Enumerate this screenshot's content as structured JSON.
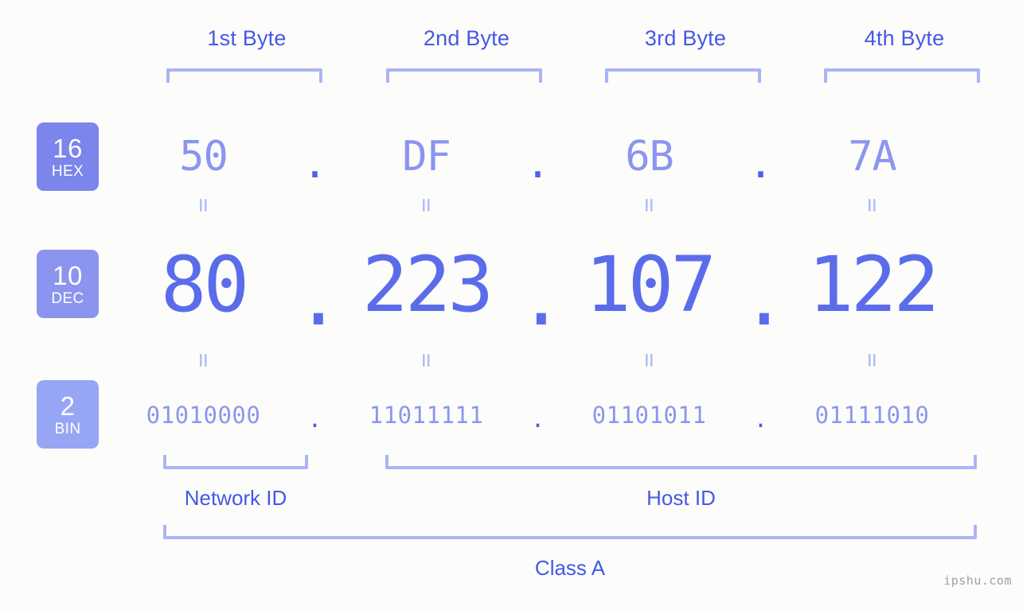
{
  "background_color": "#fcfdfa",
  "accent": {
    "label_blue": "#4558e8",
    "bracket_blue": "#aab4f7",
    "hex_value": "#8b95f0",
    "dec_value": "#5b6ceb",
    "bin_value": "#8b95f0",
    "badge_hex": "#7b85ec",
    "badge_dec": "#8b95ef",
    "badge_bin": "#97a5f5",
    "equals_mark": "#b3bdf8",
    "watermark": "#9aa0a6"
  },
  "byte_headers": [
    {
      "label": "1st Byte"
    },
    {
      "label": "2nd Byte"
    },
    {
      "label": "3rd Byte"
    },
    {
      "label": "4th Byte"
    }
  ],
  "radix_badges": [
    {
      "number": "16",
      "name": "HEX"
    },
    {
      "number": "10",
      "name": "DEC"
    },
    {
      "number": "2",
      "name": "BIN"
    }
  ],
  "rows": {
    "hex": {
      "values": [
        "50",
        "DF",
        "6B",
        "7A"
      ],
      "separator": "."
    },
    "dec": {
      "values": [
        "80",
        "223",
        "107",
        "122"
      ],
      "separator": "."
    },
    "bin": {
      "values": [
        "01010000",
        "11011111",
        "01101011",
        "01111010"
      ],
      "separator": "."
    }
  },
  "equals_mark": "=",
  "sections": {
    "network_id": "Network ID",
    "host_id": "Host ID",
    "class": "Class A"
  },
  "watermark": "ipshu.com"
}
